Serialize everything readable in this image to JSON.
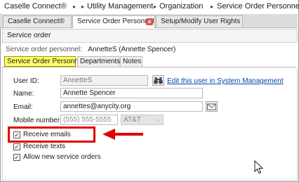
{
  "breadcrumb": {
    "items": [
      "Caselle Connect®",
      "Utility Management",
      "Organization",
      "Service Order Personnel"
    ],
    "separator": ">"
  },
  "tabs": [
    {
      "label": "Caselle Connect®",
      "active": false
    },
    {
      "label": "Service Order Personnel",
      "active": true,
      "closable": true
    },
    {
      "label": "Setup/Modify User Rights",
      "active": false
    }
  ],
  "service_order": {
    "label": "Service order"
  },
  "personnel": {
    "label": "Service order personnel:",
    "value": "AnnetteS  (Annette Spencer)"
  },
  "inner_tabs": [
    {
      "label": "Service Order Personnel",
      "active": true
    },
    {
      "label": "Departments",
      "active": false
    },
    {
      "label": "Notes",
      "active": false
    }
  ],
  "form": {
    "user_id": {
      "label": "User ID:",
      "value": "AnnetteS"
    },
    "edit_link": "Edit this user in System Management",
    "name": {
      "label": "Name:",
      "value": "Annette Spencer"
    },
    "email": {
      "label": "Email:",
      "value": "annettes@anycity.org"
    },
    "mobile": {
      "label": "Mobile number:",
      "placeholder": "(555) 555-5555",
      "carrier": "AT&T"
    }
  },
  "checkboxes": [
    {
      "label": "Receive emails",
      "checked": true
    },
    {
      "label": "Receive texts",
      "checked": true
    },
    {
      "label": "Allow new service orders",
      "checked": true
    }
  ],
  "colors": {
    "highlight": "#e10000",
    "active_tab": "#ffff66",
    "link": "#0645ad"
  }
}
